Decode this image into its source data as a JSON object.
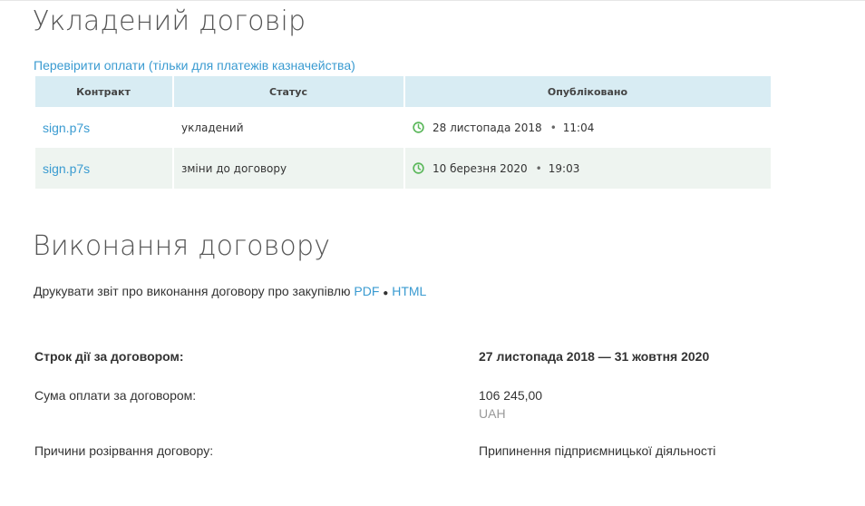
{
  "section_contract": {
    "title": "Укладений договір",
    "check_link": "Перевірити оплати (тільки для платежів казначейства)",
    "columns": [
      "Контракт",
      "Статус",
      "Опубліковано"
    ],
    "rows": [
      {
        "file": "sign.p7s",
        "status": "укладений",
        "date": "28 листопада 2018",
        "time": "11:04"
      },
      {
        "file": "sign.p7s",
        "status": "зміни до договору",
        "date": "10 березня 2020",
        "time": "19:03"
      }
    ],
    "icon": "clock-icon"
  },
  "section_execution": {
    "title": "Виконання договору",
    "report_text": "Друкувати звіт про виконання договору про закупівлю",
    "pdf_label": "PDF",
    "separator": "●",
    "html_label": "HTML",
    "term_label": "Строк дії за договором:",
    "term_value": "27 листопада 2018 — 31 жовтня 2020",
    "sum_label": "Сума оплати за договором:",
    "sum_value": "106 245,00",
    "sum_currency": "UAH",
    "termination_label": "Причини розірвання договору:",
    "termination_value": "Припинення підприємницької діяльності"
  },
  "colors": {
    "link": "#3a9bd1",
    "header_bg": "#d8ecf3",
    "alt_row_bg": "#eef4f0",
    "clock": "#5cb85c"
  }
}
